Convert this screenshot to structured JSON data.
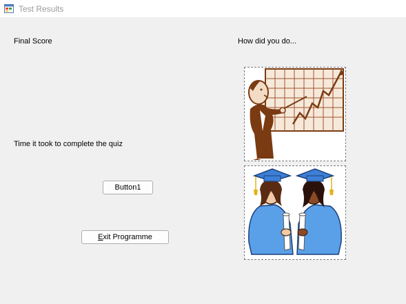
{
  "window": {
    "title": "Test Results",
    "icon": "windows-form-icon"
  },
  "labels": {
    "final_score": "Final Score",
    "how_did_you_do": "How did you do...",
    "time_taken": "Time it took to complete the quiz"
  },
  "buttons": {
    "button1": "Button1",
    "exit_mnemonic": "E",
    "exit_rest": "xit Programme"
  },
  "pictures": {
    "chart_clipart": "businessman-pointing-at-rising-chart",
    "graduates_clipart": "two-graduates-holding-diplomas"
  },
  "colors": {
    "window_bg": "#f0f0f0",
    "clipart_brown": "#7a3a12",
    "grid_fill": "#f6e9da",
    "gown_blue": "#5aa0e8",
    "cap_blue": "#3d7fd6",
    "tassel_gold": "#e3b21a"
  }
}
